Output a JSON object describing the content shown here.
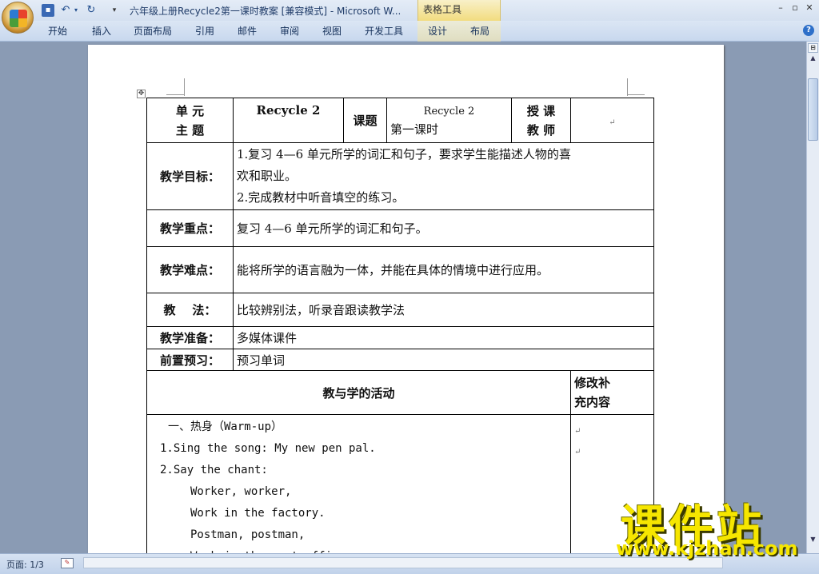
{
  "titlebar": {
    "title": "六年级上册Recycle2第一课时教案 [兼容模式] - Microsoft W...",
    "context_tab": "表格工具",
    "minimize": "–",
    "restore": "▫",
    "close": "✕"
  },
  "ribbon": {
    "tabs": [
      "开始",
      "插入",
      "页面布局",
      "引用",
      "邮件",
      "审阅",
      "视图",
      "开发工具",
      "设计",
      "布局"
    ]
  },
  "table": {
    "unit_label": [
      "单  元",
      "主  题"
    ],
    "unit_value": "Recycle  2",
    "topic_label": "课题",
    "topic_value": [
      "Recycle  2",
      "第一课时"
    ],
    "teacher_label": [
      "授  课",
      "教  师"
    ],
    "teacher_value": "",
    "goals_label": "教学目标：",
    "goals": [
      "1.复习 4—6 单元所学的词汇和句子，要求学生能描述人物的喜",
      "欢和职业。",
      "2.完成教材中听音填空的练习。"
    ],
    "key_label": "教学重点：",
    "key_value": "复习 4—6 单元所学的词汇和句子。",
    "difficult_label": "教学难点：",
    "difficult_value": "能将所学的语言融为一体，并能在具体的情境中进行应用。",
    "method_label": "教    法：",
    "method_value": "比较辨别法，听录音跟读教学法",
    "prep_label": "教学准备：",
    "prep_value": "多媒体课件",
    "preview_label": "前置预习：",
    "preview_value": "预习单词",
    "activity_header": "教与学的活动",
    "revision_header": [
      "修改补",
      "充内容"
    ],
    "activity_lines": [
      "一、热身（Warm-up）",
      "1.Sing the song: My new pen pal.",
      "2.Say the chant:",
      "Worker, worker,",
      "Work in the factory.",
      "Postman, postman,",
      "Work in the post office."
    ],
    "para_mark": "↵"
  },
  "statusbar": {
    "page_count": "页面: 1/3"
  },
  "watermark": {
    "main": "课件站",
    "url": "www.kjzhan.com"
  }
}
